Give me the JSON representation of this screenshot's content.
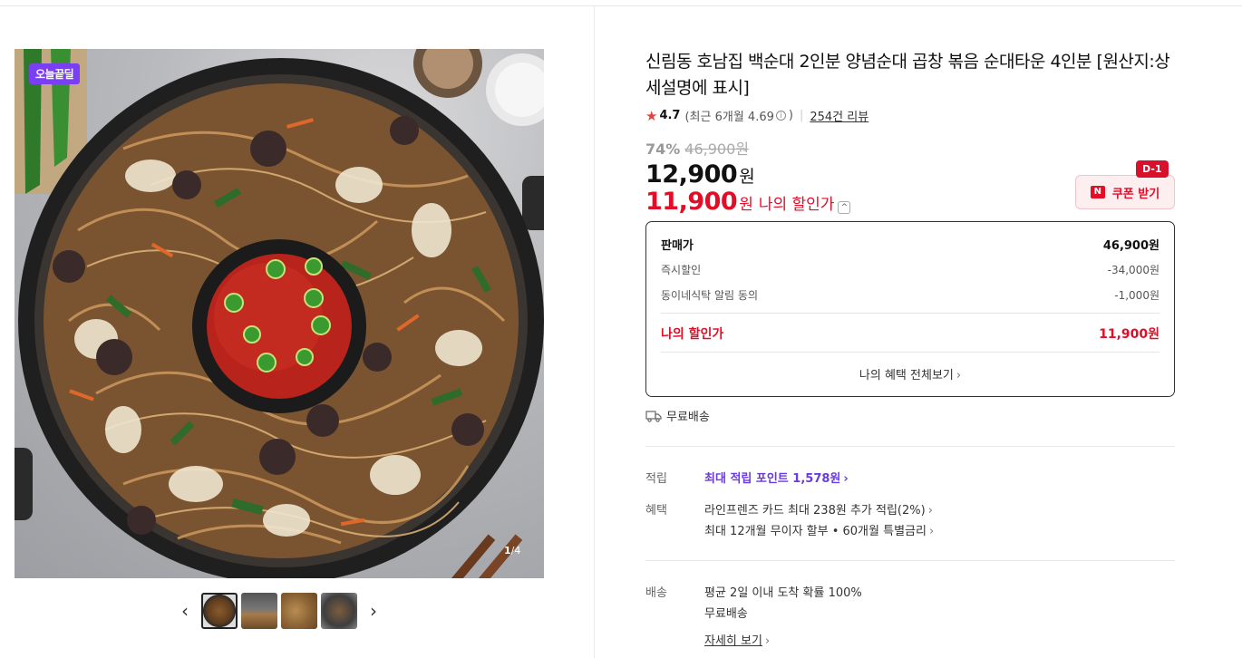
{
  "gallery": {
    "badge": "오늘끝딜",
    "counter_current": "1",
    "counter_total": "/4",
    "prev_icon": "chevron-left-icon",
    "next_icon": "chevron-right-icon",
    "thumbnail_count": 4
  },
  "product": {
    "title": "신림동 호남집 백순대 2인분 양념순대 곱창 볶음 순대타운 4인분 [원산지:상세설명에 표시]",
    "rating": {
      "score": "4.7",
      "recent": "(최근 6개월 4.69",
      "recent_close": ")",
      "reviews": "254건 리뷰"
    },
    "discount_rate": "74%",
    "original_price": "46,900원",
    "price": "12,900",
    "price_unit": "원",
    "my_price": "11,900",
    "my_price_unit": "원",
    "my_price_label": "나의 할인가",
    "coupon": {
      "label": "쿠폰 받기",
      "dday": "D-1"
    }
  },
  "price_box": {
    "rows": [
      {
        "label": "판매가",
        "value": "46,900원"
      },
      {
        "label": "즉시할인",
        "value": "-34,000원"
      },
      {
        "label": "동이네식탁 알림 동의",
        "value": "-1,000원"
      }
    ],
    "total": {
      "label": "나의 할인가",
      "value": "11,900원"
    },
    "all_benefits": "나의 혜택 전체보기"
  },
  "shipping_tag": "무료배송",
  "details": {
    "points_label": "적립",
    "points_value": "최대 적립 포인트 1,578원",
    "benefit_label": "혜택",
    "benefit_1": "라인프렌즈 카드 최대 238원 추가 적립(2%)",
    "benefit_2": "최대 12개월 무이자 할부 • 60개월 특별금리",
    "delivery_label": "배송",
    "delivery_1": "평균 2일 이내 도착 확률 100%",
    "delivery_2": "무료배송",
    "delivery_more": "자세히 보기"
  },
  "colors": {
    "accent_red": "#e10e27",
    "accent_purple": "#6a3be0",
    "badge_purple": "#7a3ff2"
  }
}
